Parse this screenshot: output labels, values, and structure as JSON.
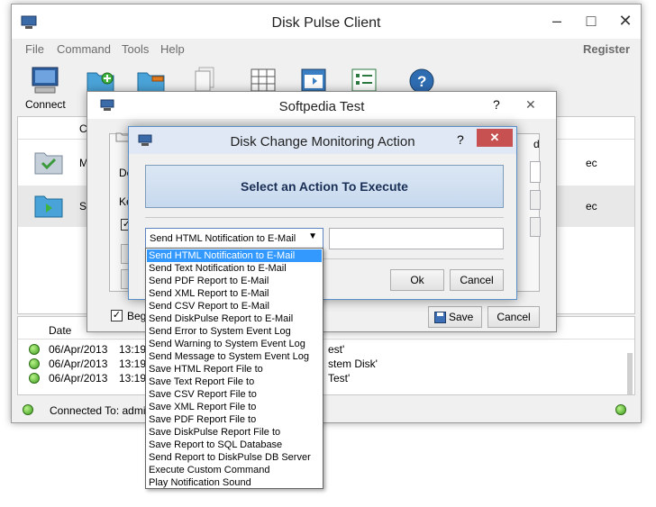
{
  "main_window": {
    "title": "Disk Pulse Client",
    "menu": [
      "File",
      "Command",
      "Tools",
      "Help"
    ],
    "register": "Register",
    "toolbar": {
      "connect_label": "Connect",
      "partial_label": "A"
    },
    "list": {
      "column_partial": "Con",
      "rows": [
        {
          "name": "Mon",
          "trailing": "ec"
        },
        {
          "name": "Soft",
          "trailing": "ec"
        }
      ]
    },
    "log": {
      "date_header": "Date",
      "rows": [
        {
          "date": "06/Apr/2013",
          "time": "13:19:0",
          "message": "est'"
        },
        {
          "date": "06/Apr/2013",
          "time": "13:19:0",
          "message": "stem Disk'"
        },
        {
          "date": "06/Apr/2013",
          "time": "13:19:0",
          "message": "Test'"
        }
      ]
    },
    "status": "Connected To: admi"
  },
  "softpedia_window": {
    "title": "Softpedia Test",
    "help": "?",
    "close": "✕",
    "field_labels": [
      "De",
      "Ke"
    ],
    "begin_label": "Begi",
    "partial_d": "d",
    "save_label": "Save",
    "cancel_label": "Cancel"
  },
  "action_dialog": {
    "title": "Disk Change Monitoring Action",
    "help": "?",
    "close": "✕",
    "banner": "Select an Action To Execute",
    "selected_action": "Send HTML Notification to E-Mail",
    "argument_value": "",
    "ok_label": "Ok",
    "cancel_label": "Cancel",
    "options": [
      "Send HTML Notification to E-Mail",
      "Send Text Notification to E-Mail",
      "Send PDF Report to E-Mail",
      "Send XML Report to E-Mail",
      "Send CSV Report to E-Mail",
      "Send DiskPulse Report to E-Mail",
      "Send Error to System Event Log",
      "Send Warning to System Event Log",
      "Send Message to System Event Log",
      "Save HTML Report File to",
      "Save Text Report File to",
      "Save CSV Report File to",
      "Save XML Report File to",
      "Save PDF Report File to",
      "Save DiskPulse Report File to",
      "Save Report to SQL Database",
      "Send Report to DiskPulse DB Server",
      "Execute Custom Command",
      "Play Notification Sound"
    ]
  }
}
